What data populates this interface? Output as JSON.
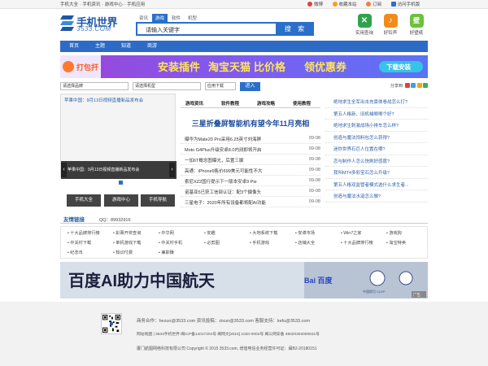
{
  "topbar": {
    "links": [
      "手机大全",
      "手机资讯",
      "游戏中心",
      "手机应用"
    ],
    "right": [
      "微博",
      "收藏本站",
      "订阅",
      "访问手机版"
    ]
  },
  "logo": {
    "main": "手机世界",
    "sub": "3533.COM"
  },
  "search": {
    "tabs": [
      "资讯",
      "游戏",
      "软件",
      "机型"
    ],
    "active_tab": "游戏",
    "placeholder": "请输入关键字",
    "button": "搜 索"
  },
  "apps": [
    {
      "label": "实用查询",
      "icon": "tools-icon",
      "color": "#2fa34b",
      "glyph": "✕"
    },
    {
      "label": "好铃声",
      "icon": "music-icon",
      "color": "#f08b1c",
      "glyph": "♪"
    },
    {
      "label": "好壁纸",
      "icon": "wallpaper-icon",
      "color": "#6cc13d",
      "glyph": "壁"
    }
  ],
  "nav": [
    "首页",
    "主题",
    "知道",
    "商游"
  ],
  "banner": {
    "brand": "打包扞",
    "text1": "安装插件",
    "text2": "淘宝天猫",
    "text3": "比价格",
    "text4": "领优惠券",
    "cta": "下载安装"
  },
  "filters": {
    "brand": "请选择品牌",
    "model": "请选择机型",
    "type": "应用下载",
    "go": "进入",
    "share": "分享到:"
  },
  "slider": {
    "caption": "苹果中国：9月13日视频直播新品发布会",
    "image_caption": "苹果中国：9月13日视频直播新品发布会"
  },
  "quick_buttons": [
    "手机大全",
    "游戏中心",
    "手机导航"
  ],
  "news": {
    "tabs": [
      "游戏资讯",
      "软件教程",
      "游戏攻略",
      "使用教程"
    ],
    "headline": "三星折叠屏智能机有望今年11月亮相",
    "items": [
      {
        "title": "曝华为Mate20 Pro采用6.25英寸刘海屏",
        "date": "09-08"
      },
      {
        "title": "Moto G4Plus升级安卓8.0内测即将开启",
        "date": "09-08"
      },
      {
        "title": "一加6T概念图曝光，后置三摄",
        "date": "09-08"
      },
      {
        "title": "高通：iPhone9售价699美元可能性不大",
        "date": "09-08"
      },
      {
        "title": "索尼XZ2国行提示下一版本安卓9 Pie",
        "date": "09-08"
      },
      {
        "title": "诺基亚5已获工信部认证：配3个摄像头",
        "date": "09-08"
      },
      {
        "title": "三星电子：2020年所有设备都将配AI功能",
        "date": "09-08"
      }
    ]
  },
  "questions": [
    "绝地求生全军出击充豪体卷战怎么打?",
    "第五人格新、旧机械唧唧个好?",
    "绝地求生刺激战场小排车怎么样?",
    "创造与魔法饲料包怎么获得?",
    "迷你世界石巨人位置在哪?",
    "恋与制作人怎么快刷好感度?",
    "我叫MT4多彩宝石怎么升级?",
    "第五人格双监管者模式选什么求生者...",
    "创造与魔法水涎怎么做?"
  ],
  "links": {
    "title": "友情链接",
    "qq": "QQ：89932916",
    "items": [
      "十大品牌排行榜",
      "彩票开奖查询",
      "中华网",
      "安趣",
      "大地系统下载",
      "安卓市场",
      "Win7之家",
      "游戏狗",
      "中关村下载",
      "单机游戏下载",
      "中关村手机",
      "必剪图",
      "手机游戏",
      "店铺大全",
      "十大品牌排行榜",
      "淘宝特卖",
      "纪念币",
      "知识付费",
      "兼职赚"
    ]
  },
  "bottom_ad": {
    "text": "百度AI助力中国航天",
    "brand": "Bai 百度",
    "partner": "中国探月 CLEP",
    "tag": "广告"
  },
  "footer": {
    "contact": "商务合作：hezuo@3533.com    资讯投稿：zixun@3533.com    客服支持：kefu@3533.com",
    "links": "网站地图  |  3533手机世界 闽ICP备14017204号  闽网文[2015] 1020-0002号  闽公网安备 35020302000931号",
    "copyright": "厦门航图网络科技有限公司 Copyright © 2015 3533.com, 增值电信业务经营许可证：闽B2-20180151"
  }
}
